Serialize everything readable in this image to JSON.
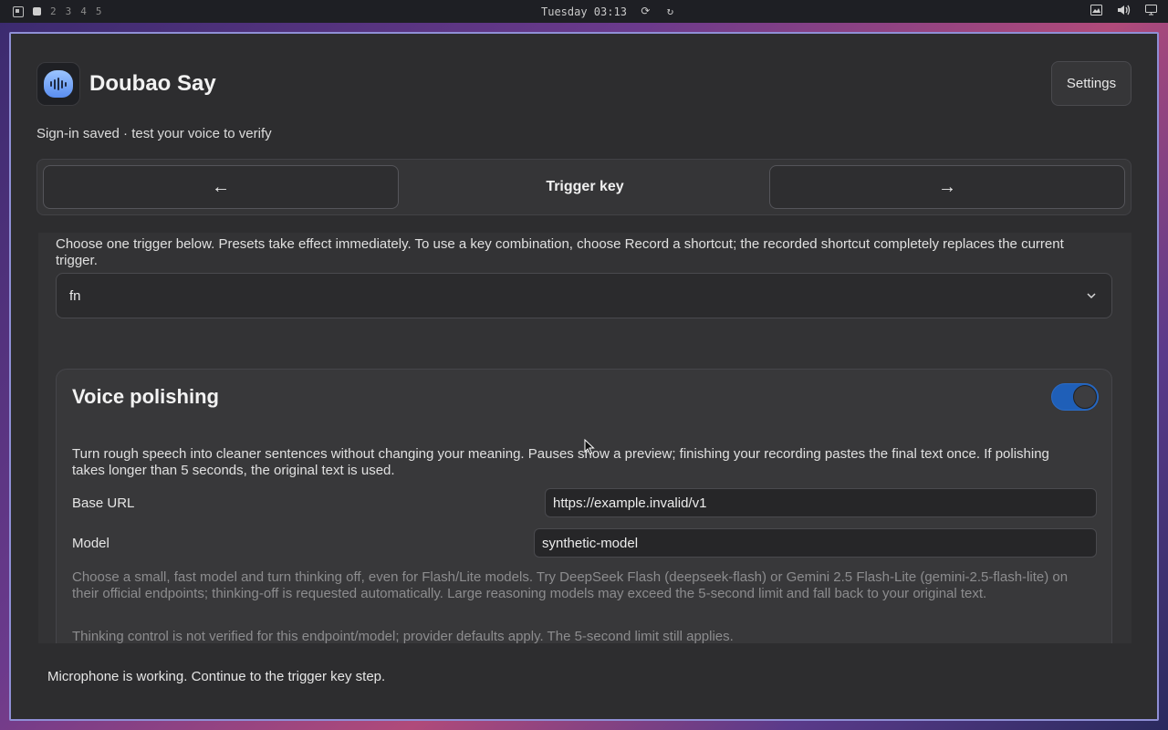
{
  "topbar": {
    "workspaces": [
      "2",
      "3",
      "4",
      "5"
    ],
    "clock": "Tuesday 03:13"
  },
  "app": {
    "title": "Doubao Say",
    "settings_label": "Settings",
    "status": "Sign-in saved · test your voice to verify"
  },
  "nav": {
    "prev_glyph": "←",
    "next_glyph": "→",
    "title": "Trigger key"
  },
  "trigger": {
    "description": "Choose one trigger below. Presets take effect immediately. To use a key combination, choose Record a shortcut; the recorded shortcut completely replaces the current trigger.",
    "selected": "fn"
  },
  "polishing": {
    "title": "Voice polishing",
    "enabled": true,
    "description": "Turn rough speech into cleaner sentences without changing your meaning. Pauses show a preview; finishing your recording pastes the final text once. If polishing takes longer than 5 seconds, the original text is used.",
    "base_url_label": "Base URL",
    "base_url_value": "https://example.invalid/v1",
    "model_label": "Model",
    "model_value": "synthetic-model",
    "hint1": "Choose a small, fast model and turn thinking off, even for Flash/Lite models. Try DeepSeek Flash (deepseek-flash) or Gemini 2.5 Flash-Lite (gemini-2.5-flash-lite) on their official endpoints; thinking-off is requested automatically. Large reasoning models may exceed the 5-second limit and fall back to your original text.",
    "hint2": "Thinking control is not verified for this endpoint/model; provider defaults apply. The 5-second limit still applies."
  },
  "footer": {
    "message": "Microphone is working. Continue to the trigger key step."
  },
  "colors": {
    "accent": "#1f5fb8",
    "window_border": "#8f8fd6"
  }
}
